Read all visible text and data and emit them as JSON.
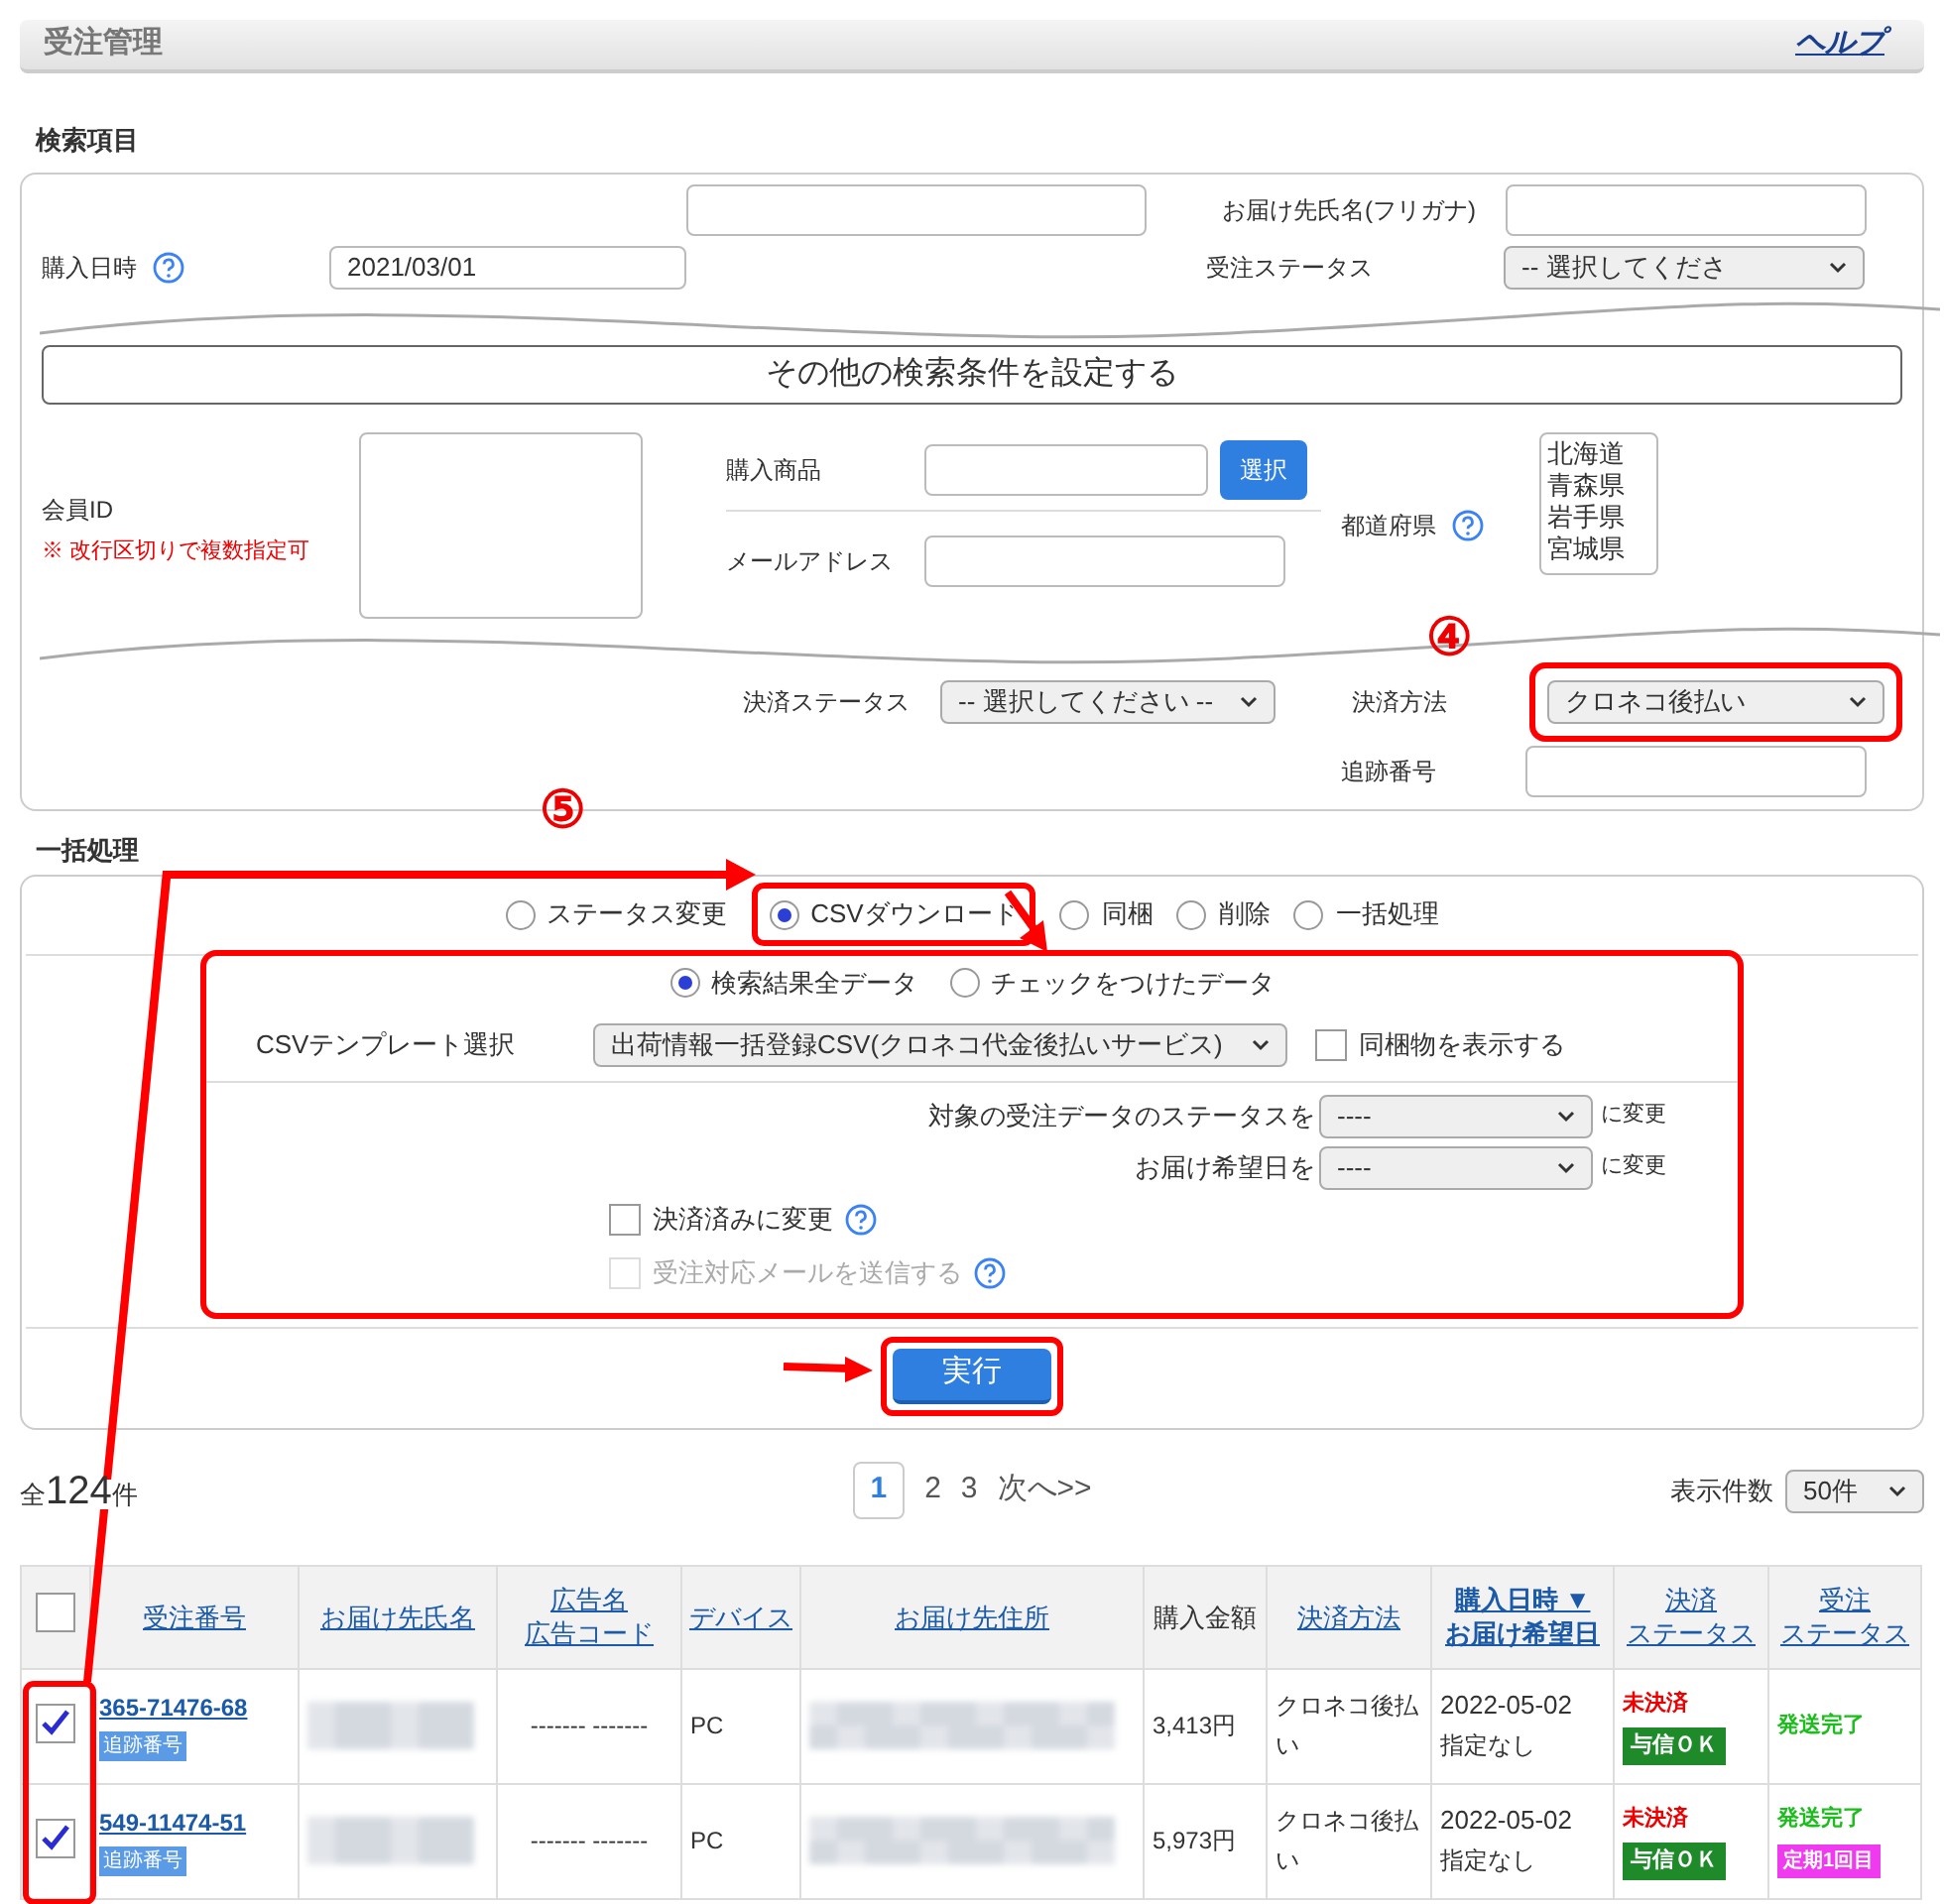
{
  "header": {
    "title": "受注管理",
    "help": "ヘルプ"
  },
  "search": {
    "title": "検索項目",
    "kana_label": "お届け先氏名(フリガナ)",
    "date_label": "購入日時",
    "date_value": "2021/03/01",
    "order_status_label": "受注ステータス",
    "order_status_value": "-- 選択してくださ",
    "more_button": "その他の検索条件を設定する",
    "member_label": "会員ID",
    "member_note": "※ 改行区切りで複数指定可",
    "product_label": "購入商品",
    "select_button": "選択",
    "prefecture_label": "都道府県",
    "prefectures": [
      "北海道",
      "青森県",
      "岩手県",
      "宮城県"
    ],
    "email_label": "メールアドレス",
    "payment_status_label": "決済ステータス",
    "payment_status_value": "-- 選択してください --",
    "payment_method_label": "決済方法",
    "payment_method_value": "クロネコ後払い",
    "tracking_label": "追跡番号",
    "marker": "④"
  },
  "bulk": {
    "title": "一括処理",
    "marker": "⑤",
    "modes": [
      {
        "label": "ステータス変更",
        "selected": false
      },
      {
        "label": "CSVダウンロード",
        "selected": true
      },
      {
        "label": "同梱",
        "selected": false
      },
      {
        "label": "削除",
        "selected": false
      },
      {
        "label": "一括処理",
        "selected": false
      }
    ],
    "targets": [
      {
        "label": "検索結果全データ",
        "selected": true
      },
      {
        "label": "チェックをつけたデータ",
        "selected": false
      }
    ],
    "template_label": "CSVテンプレート選択",
    "template_value": "出荷情報一括登録CSV(クロネコ代金後払いサービス)",
    "bundle_check": {
      "label": "同梱物を表示する",
      "checked": false,
      "disabled": false
    },
    "status_change": {
      "label": "対象の受注データのステータスを",
      "value": "----",
      "suffix": "に変更"
    },
    "delivery_change": {
      "label": "お届け希望日を",
      "value": "----",
      "suffix": "に変更"
    },
    "options": [
      {
        "label": "決済済みに変更",
        "checked": false,
        "disabled": false
      },
      {
        "label": "受注対応メールを送信する",
        "checked": false,
        "disabled": true
      }
    ],
    "run": "実行"
  },
  "results": {
    "total_prefix": "全",
    "total": "124",
    "total_suffix": "件",
    "pages": [
      {
        "label": "1",
        "selected": true
      },
      {
        "label": "2",
        "selected": false
      },
      {
        "label": "3",
        "selected": false
      },
      {
        "label": "次へ>>",
        "selected": false
      }
    ],
    "per_page_label": "表示件数",
    "per_page_value": "50件"
  },
  "table": {
    "header_checked": false,
    "columns": [
      {
        "lines": [
          "受注番号"
        ],
        "link": true,
        "sorted": false
      },
      {
        "lines": [
          "お届け先氏名"
        ],
        "link": true,
        "sorted": false
      },
      {
        "lines": [
          "広告名",
          "広告コード"
        ],
        "link": true,
        "sorted": false
      },
      {
        "lines": [
          "デバイス"
        ],
        "link": true,
        "sorted": false
      },
      {
        "lines": [
          "お届け先住所"
        ],
        "link": true,
        "sorted": false
      },
      {
        "lines": [
          "購入金額"
        ],
        "link": false,
        "sorted": false
      },
      {
        "lines": [
          "決済方法"
        ],
        "link": true,
        "sorted": false
      },
      {
        "lines": [
          "購入日時 ▼",
          "お届け希望日"
        ],
        "link": true,
        "sorted": true
      },
      {
        "lines": [
          "決済",
          "ステータス"
        ],
        "link": true,
        "sorted": false
      },
      {
        "lines": [
          "受注",
          "ステータス"
        ],
        "link": true,
        "sorted": false
      }
    ],
    "rows": [
      {
        "checked": true,
        "order_no": "365-71476-68",
        "tracking": "追跡番号",
        "ad": "------- -------",
        "device": "PC",
        "amount": "3,413円",
        "payment": "クロネコ後払い",
        "date": "2022-05-02",
        "delivery": "指定なし",
        "pay_status": "未決済",
        "credit": "与信ＯＫ",
        "order_status": "発送完了",
        "tags": []
      },
      {
        "checked": true,
        "order_no": "549-11474-51",
        "tracking": "追跡番号",
        "ad": "------- -------",
        "device": "PC",
        "amount": "5,973円",
        "payment": "クロネコ後払い",
        "date": "2022-05-02",
        "delivery": "指定なし",
        "pay_status": "未決済",
        "credit": "与信ＯＫ",
        "order_status": "発送完了",
        "tags": [
          "定期1回目"
        ]
      }
    ]
  }
}
